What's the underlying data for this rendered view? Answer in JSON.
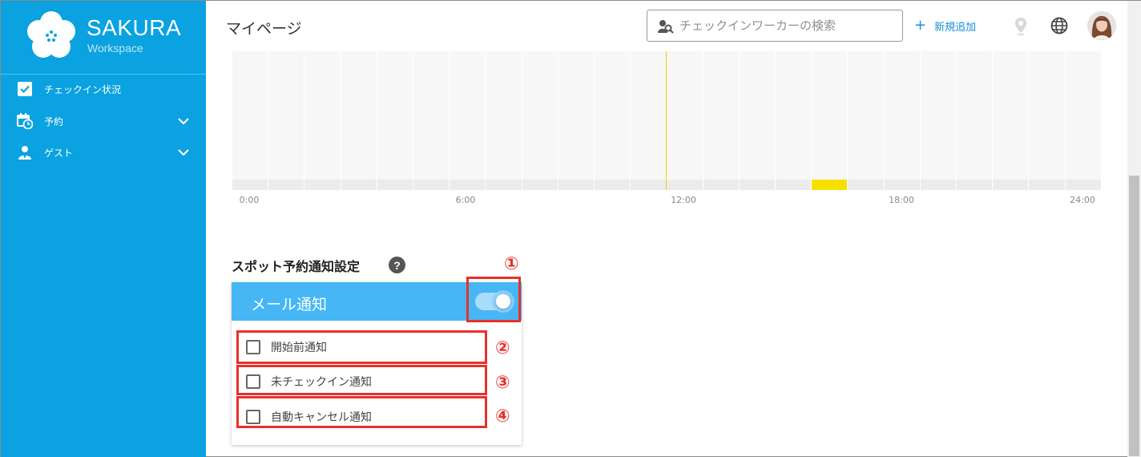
{
  "brand": {
    "name": "SAKURA",
    "sub": "Workspace"
  },
  "sidebar": {
    "items": [
      {
        "label": "チェックイン状況",
        "icon": "checkbox-icon"
      },
      {
        "label": "予約",
        "icon": "calendar-clock-icon",
        "chevron": "chevron-down-icon"
      },
      {
        "label": "ゲスト",
        "icon": "guest-icon",
        "chevron": "chevron-down-icon"
      }
    ]
  },
  "header": {
    "title": "マイページ",
    "search_placeholder": "チェックインワーカーの検索",
    "add_label": "新規追加",
    "add_plus": "+"
  },
  "timeline": {
    "ticks": [
      "0:00",
      "6:00",
      "12:00",
      "18:00",
      "24:00"
    ],
    "current_time_marker": "11:45",
    "booked_range": [
      "16:00",
      "17:00"
    ]
  },
  "notify": {
    "section_title": "スポット予約通知設定",
    "help": "?",
    "card_title": "メール通知",
    "toggle_on": true,
    "options": [
      {
        "label": "開始前通知",
        "checked": false
      },
      {
        "label": "未チェックイン通知",
        "checked": false
      },
      {
        "label": "自動キャンセル通知",
        "checked": false
      }
    ]
  },
  "annotations": [
    "①",
    "②",
    "③",
    "④"
  ],
  "colors": {
    "sidebar": "#0aa2e0",
    "card_head": "#46b7f4",
    "accent": "#1a8fd6",
    "annotation": "#e8312c",
    "busy": "#f7e000"
  }
}
